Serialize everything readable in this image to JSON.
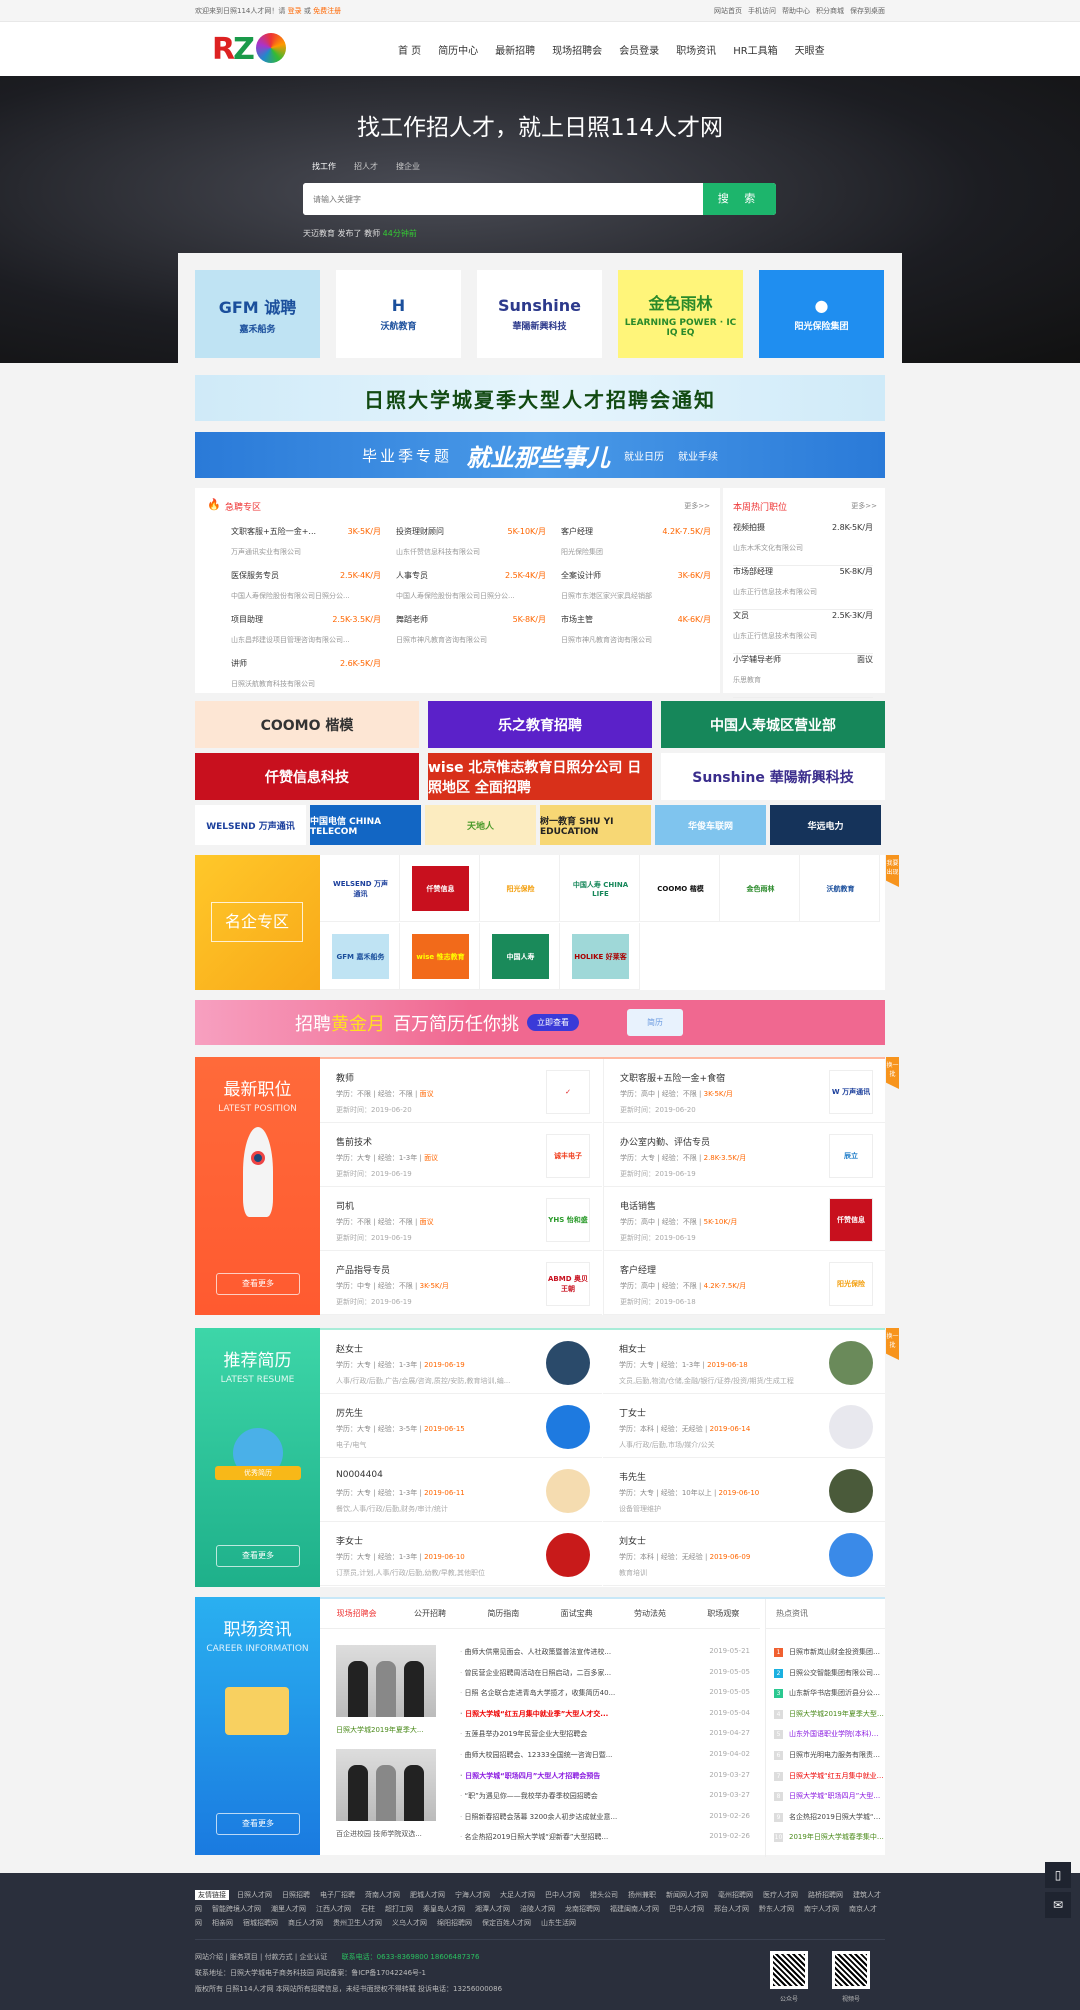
{
  "topbar": {
    "welcome": "欢迎来到日照114人才网！请",
    "login": "登录",
    "or": "或",
    "register": "免费注册",
    "links": [
      "网站首页",
      "手机访问",
      "帮助中心",
      "积分商城",
      "保存到桌面"
    ]
  },
  "header": {
    "logo_text": "RZ",
    "nav": [
      "首 页",
      "简历中心",
      "最新招聘",
      "现场招聘会",
      "会员登录",
      "职场资讯",
      "HR工具箱",
      "天眼查"
    ]
  },
  "hero": {
    "title": "找工作招人才，就上日照114人才网",
    "tabs": [
      "找工作",
      "招人才",
      "搜企业"
    ],
    "search_placeholder": "请输入关键字",
    "search_button": "搜 索",
    "recent": {
      "company": "天迈教育",
      "action": "发布了",
      "job": "教师",
      "time": "44分钟前"
    }
  },
  "top_logos": [
    {
      "line1": "GFM 诚聘",
      "line2": "嘉禾船务",
      "bg": "#bfe3f3",
      "color": "#1b4f9c"
    },
    {
      "line1": "H",
      "line2": "沃航教育",
      "bg": "#ffffff",
      "color": "#1b4f9c"
    },
    {
      "line1": "Sunshine",
      "line2": "華陽新興科技",
      "bg": "#ffffff",
      "color": "#2d3a8c"
    },
    {
      "line1": "金色雨林",
      "line2": "LEARNING POWER · IC IQ EQ",
      "bg": "#fff57a",
      "color": "#2a8a2a"
    },
    {
      "line1": "●",
      "line2": "阳光保险集团",
      "bg": "#1f8ef0",
      "color": "#ffffff"
    }
  ],
  "banners": {
    "fair": "日照大学城夏季大型人才招聘会通知",
    "grad_prefix": "毕业季专题",
    "grad_title": "就业那些事儿",
    "grad_links": [
      "就业日历",
      "就业手续"
    ]
  },
  "urgent": {
    "title": "急聘专区",
    "more": "更多>>",
    "items": [
      {
        "job": "文职客服+五险一金+...",
        "salary": "3K-5K/月",
        "company": "万声通讯实业有限公司"
      },
      {
        "job": "投资理财顾问",
        "salary": "5K-10K/月",
        "company": "山东仟赞信息科技有限公司"
      },
      {
        "job": "客户经理",
        "salary": "4.2K-7.5K/月",
        "company": "阳光保险集团"
      },
      {
        "job": "医保服务专员",
        "salary": "2.5K-4K/月",
        "company": "中国人寿保险股份有限公司日照分公..."
      },
      {
        "job": "人事专员",
        "salary": "2.5K-4K/月",
        "company": "中国人寿保险股份有限公司日照分公..."
      },
      {
        "job": "全案设计师",
        "salary": "3K-6K/月",
        "company": "日照市东港区家兴家具经销部"
      },
      {
        "job": "项目助理",
        "salary": "2.5K-3.5K/月",
        "company": "山东昌邦建设项目管理咨询有限公司..."
      },
      {
        "job": "舞蹈老师",
        "salary": "5K-8K/月",
        "company": "日照市神凡教育咨询有限公司"
      },
      {
        "job": "市场主管",
        "salary": "4K-6K/月",
        "company": "日照市神凡教育咨询有限公司"
      },
      {
        "job": "讲师",
        "salary": "2.6K-5K/月",
        "company": "日照沃航教育科技有限公司"
      }
    ]
  },
  "hot": {
    "title": "本周热门职位",
    "more": "更多>>",
    "items": [
      {
        "job": "视频拍摄",
        "salary": "2.8K-5K/月",
        "company": "山东木禾文化有限公司"
      },
      {
        "job": "市场部经理",
        "salary": "5K-8K/月",
        "company": "山东正行信息技术有限公司"
      },
      {
        "job": "文员",
        "salary": "2.5K-3K/月",
        "company": "山东正行信息技术有限公司"
      },
      {
        "job": "小学辅导老师",
        "salary": "面议",
        "company": "乐思教育"
      }
    ]
  },
  "ads": [
    {
      "text": "COOMO 楷模",
      "bg": "#fde6d4",
      "color": "#333"
    },
    {
      "text": "乐之教育招聘",
      "bg": "#5b21c9",
      "color": "#fff"
    },
    {
      "text": "中国人寿城区营业部",
      "bg": "#16875a",
      "color": "#fff"
    },
    {
      "text": "仟赞信息科技",
      "bg": "#c8101e",
      "color": "#fff"
    },
    {
      "text": "wise 北京惟志教育日照分公司 日照地区 全面招聘",
      "bg": "#d8301a",
      "color": "#fff"
    },
    {
      "text": "Sunshine 華陽新興科技",
      "bg": "#ffffff",
      "color": "#3a2d8c"
    }
  ],
  "small_ads": [
    {
      "text": "WELSEND 万声通讯",
      "bg": "#fff",
      "color": "#1b3f9c"
    },
    {
      "text": "中国电信 CHINA TELECOM",
      "bg": "#1266c4",
      "color": "#fff"
    },
    {
      "text": "天地人",
      "bg": "#fcecc0",
      "color": "#4a9a2a"
    },
    {
      "text": "树一教育 SHU YI EDUCATION",
      "bg": "#f7d774",
      "color": "#222"
    },
    {
      "text": "华俊车联网",
      "bg": "#7fc4ee",
      "color": "#fff"
    },
    {
      "text": "华远电力",
      "bg": "#15335a",
      "color": "#fff"
    }
  ],
  "famous": {
    "title": "名企专区",
    "side_tag": "我要出现",
    "logos": [
      {
        "text": "WELSEND 万声通讯",
        "bg": "#fff",
        "color": "#1b3f9c"
      },
      {
        "text": "仟赞信息",
        "bg": "#c8101e",
        "color": "#fff"
      },
      {
        "text": "阳光保险",
        "bg": "#fff",
        "color": "#f3a010"
      },
      {
        "text": "中国人寿 CHINA LIFE",
        "bg": "#fff",
        "color": "#16875a"
      },
      {
        "text": "COOMO 楷模",
        "bg": "#fff",
        "color": "#111"
      },
      {
        "text": "金色雨林",
        "bg": "#fff",
        "color": "#2a8a2a"
      },
      {
        "text": "沃航教育",
        "bg": "#fff",
        "color": "#1b4f9c"
      },
      {
        "text": "GFM 嘉禾船务",
        "bg": "#bfe3f3",
        "color": "#1b4f9c"
      },
      {
        "text": "wise 惟志教育",
        "bg": "#f26a1a",
        "color": "#ff0"
      },
      {
        "text": "中国人寿",
        "bg": "#1a8a5a",
        "color": "#fff"
      },
      {
        "text": "HOLIKE 好莱客",
        "bg": "#9fd8d8",
        "color": "#a00"
      }
    ]
  },
  "gold_banner": {
    "prefix": "招聘",
    "highlight": "黄金月",
    "text": "百万简历任你挑",
    "button": "立即查看",
    "card": "简历"
  },
  "latest": {
    "title": "最新职位",
    "subtitle": "LATEST POSITION",
    "more": "查看更多",
    "side_tag": "换一批",
    "edu_label": "学历：",
    "exp_label": "经验：",
    "time_label": "更新时间：",
    "items": [
      {
        "job": "教师",
        "edu": "不限",
        "exp": "不限",
        "salary": "面议",
        "date": "2019-06-20",
        "logo": "✓",
        "bg": "#fff",
        "color": "#e02020"
      },
      {
        "job": "文职客服+五险一金+食宿",
        "edu": "高中",
        "exp": "不限",
        "salary": "3K-5K/月",
        "date": "2019-06-20",
        "logo": "W 万声通讯",
        "bg": "#fff",
        "color": "#1b3f9c"
      },
      {
        "job": "售前技术",
        "edu": "大专",
        "exp": "1-3年",
        "salary": "面议",
        "date": "2019-06-19",
        "logo": "诚丰电子",
        "bg": "#fff",
        "color": "#f04020"
      },
      {
        "job": "办公室内勤、评估专员",
        "edu": "大专",
        "exp": "不限",
        "salary": "2.8K-3.5K/月",
        "date": "2019-06-19",
        "logo": "辰立",
        "bg": "#fff",
        "color": "#1a7ac8"
      },
      {
        "job": "司机",
        "edu": "不限",
        "exp": "不限",
        "salary": "面议",
        "date": "2019-06-19",
        "logo": "YHS 怡和盛",
        "bg": "#fff",
        "color": "#2a9a2a"
      },
      {
        "job": "电话销售",
        "edu": "高中",
        "exp": "不限",
        "salary": "5K-10K/月",
        "date": "2019-06-19",
        "logo": "仟赞信息",
        "bg": "#c8101e",
        "color": "#fff"
      },
      {
        "job": "产品指导专员",
        "edu": "中专",
        "exp": "不限",
        "salary": "3K-5K/月",
        "date": "2019-06-19",
        "logo": "ABMD 奥贝王朝",
        "bg": "#fff",
        "color": "#c8101e"
      },
      {
        "job": "客户经理",
        "edu": "高中",
        "exp": "不限",
        "salary": "4.2K-7.5K/月",
        "date": "2019-06-18",
        "logo": "阳光保险",
        "bg": "#fff",
        "color": "#f3a010"
      }
    ]
  },
  "resume": {
    "title": "推荐简历",
    "subtitle": "LATEST RESUME",
    "badge": "优秀简历",
    "more": "查看更多",
    "side_tag": "换一批",
    "edu_label": "学历：",
    "exp_label": "经验：",
    "items": [
      {
        "name": "赵女士",
        "edu": "大专",
        "exp": "1-3年",
        "date": "2019-06-19",
        "intent": "人事/行政/后勤,广告/会展/咨询,质控/安防,教育培训,编...",
        "bg": "#2a4a6a"
      },
      {
        "name": "相女士",
        "edu": "大专",
        "exp": "1-3年",
        "date": "2019-06-18",
        "intent": "文员,后勤,物流/仓储,金融/银行/证券/投资/期货/生成工程",
        "bg": "#6a8a5a"
      },
      {
        "name": "厉先生",
        "edu": "大专",
        "exp": "3-5年",
        "date": "2019-06-15",
        "intent": "电子/电气",
        "bg": "#1e7ae0"
      },
      {
        "name": "丁女士",
        "edu": "本科",
        "exp": "无经验",
        "date": "2019-06-14",
        "intent": "人事/行政/后勤,市场/媒介/公关",
        "bg": "#e8e8ee"
      },
      {
        "name": "N0004404",
        "edu": "大专",
        "exp": "1-3年",
        "date": "2019-06-11",
        "intent": "餐饮,人事/行政/后勤,财务/审计/统计",
        "bg": "#f5dcb0"
      },
      {
        "name": "韦先生",
        "edu": "大专",
        "exp": "10年以上",
        "date": "2019-06-10",
        "intent": "设备管理维护",
        "bg": "#4a5a3a"
      },
      {
        "name": "李女士",
        "edu": "大专",
        "exp": "1-3年",
        "date": "2019-06-10",
        "intent": "订票员,计划,人事/行政/后勤,幼教/早教,其他职位",
        "bg": "#c81a1a"
      },
      {
        "name": "刘女士",
        "edu": "本科",
        "exp": "无经验",
        "date": "2019-06-09",
        "intent": "教育培训",
        "bg": "#3a8ae8"
      }
    ]
  },
  "news": {
    "title": "职场资讯",
    "subtitle": "CAREER INFORMATION",
    "more": "查看更多",
    "tabs": [
      "现场招聘会",
      "公开招聘",
      "简历指南",
      "面试宝典",
      "劳动法苑",
      "职场观察"
    ],
    "image_captions": [
      "日照大学城2019年夏季大...",
      "百企进校园 技师学院双选..."
    ],
    "items": [
      {
        "title": "曲师大供需见面会、人社政策暨普法宣传进校...",
        "date": "2019-05-21",
        "color": "#444"
      },
      {
        "title": "曾民营企业招聘周活动在日照启动，二百多家...",
        "date": "2019-05-05",
        "color": "#444"
      },
      {
        "title": "日照 名企联合走进青岛大学揽才，收集简历40...",
        "date": "2019-05-05",
        "color": "#444"
      },
      {
        "title": "日照大学城“红五月集中就业季”大型人才交...",
        "date": "2019-05-04",
        "color": "#e00"
      },
      {
        "title": "五莲县举办2019年民营企业大型招聘会",
        "date": "2019-04-27",
        "color": "#444"
      },
      {
        "title": "曲师大校园招聘会、12333全国统一咨询日暨...",
        "date": "2019-04-02",
        "color": "#444"
      },
      {
        "title": "日照大学城“职场四月”大型人才招聘会预告",
        "date": "2019-03-27",
        "color": "#8a1ae0"
      },
      {
        "title": "“职”为遇见你——我校举办春季校园招聘会",
        "date": "2019-03-27",
        "color": "#444"
      },
      {
        "title": "日照新春招聘会落幕 3200余人初步达成就业意...",
        "date": "2019-02-26",
        "color": "#444"
      },
      {
        "title": "名企热招2019日照大学城“迎新春”大型招聘...",
        "date": "2019-02-26",
        "color": "#444"
      }
    ],
    "hot_title": "热点资讯",
    "hot": [
      {
        "title": "日照市新岚山财金投资集团有限公...",
        "color": "#444",
        "badge": "#f06030"
      },
      {
        "title": "日照公交智能集团有限公司招聘公...",
        "color": "#444",
        "badge": "#1ab0e0"
      },
      {
        "title": "山东新华书店集团沂县分公司201...",
        "color": "#444",
        "badge": "#2ac890"
      },
      {
        "title": "日照大学城2019年夏季大型招聘...",
        "color": "#4a8a1a",
        "badge": "#ddd"
      },
      {
        "title": "山东外国语职业学院(本科)教师招...",
        "color": "#8a1ae0",
        "badge": "#ddd"
      },
      {
        "title": "日照市光明电力服务有限责任公司...",
        "color": "#444",
        "badge": "#ddd"
      },
      {
        "title": "日照大学城“红五月集中就业季”...",
        "color": "#e00",
        "badge": "#ddd"
      },
      {
        "title": "日照大学城“职场四月”大型人才...",
        "color": "#8a1ae0",
        "badge": "#ddd"
      },
      {
        "title": "名企热招2019日照大学城“迎新...",
        "color": "#444",
        "badge": "#ddd"
      },
      {
        "title": "2019年日照大学城春季集中就业...",
        "color": "#4a8a1a",
        "badge": "#ddd"
      }
    ]
  },
  "footer": {
    "links_label": "友情链接",
    "links": [
      "日照人才网",
      "日照招聘",
      "电子厂招聘",
      "菏南人才网",
      "肥城人才网",
      "宁海人才网",
      "大足人才网",
      "巴中人才网",
      "猎头公司",
      "扬州兼职",
      "新闻网人才网",
      "亳州招聘网",
      "医疗人才网",
      "路桥招聘网",
      "建筑人才网",
      "智能跨境人才网",
      "潮里人才网",
      "江西人才网",
      "石柱",
      "超打工网",
      "秦皇岛人才网",
      "湘潭人才网",
      "涪陵人才网",
      "龙南招聘网",
      "福建闽南人才网",
      "巴中人才网",
      "邢台人才网",
      "黔东人才网",
      "南宁人才网",
      "南京人才网",
      "相亲网",
      "宿城招聘网",
      "商丘人才网",
      "贵州卫生人才网",
      "义乌人才网",
      "绵阳招聘网",
      "保定百姓人才网",
      "山东生活网"
    ],
    "nav": [
      "网站介绍",
      "服务项目",
      "付款方式",
      "企业认证"
    ],
    "phone": "联系电话：0633-8369800 18606487376",
    "address": "联系地址：日照大学城电子商务科技园  网站备案：鲁ICP备17042246号-1",
    "copyright": "版权所有 日照114人才网 本网站所有招聘信息，未经书面授权不得转载 投诉电话：13256000086",
    "qr": [
      "公众号",
      "视频号"
    ]
  }
}
